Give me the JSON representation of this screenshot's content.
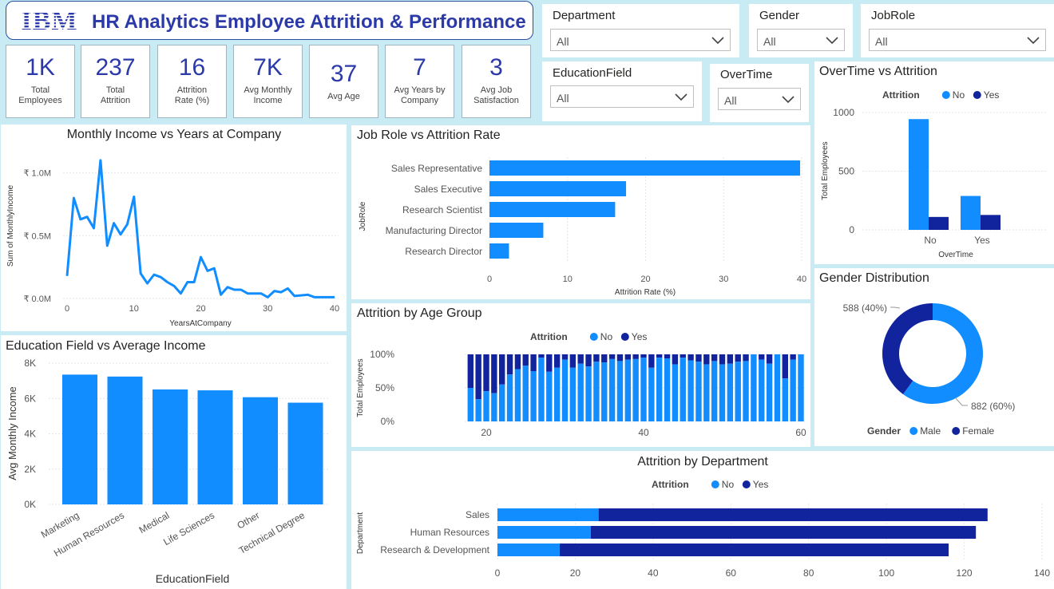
{
  "header": {
    "logo_text": "IBM",
    "title": "HR Analytics Employee Attrition & Performance"
  },
  "kpis": [
    {
      "value": "1K",
      "label_lines": [
        "Total",
        "Employees"
      ]
    },
    {
      "value": "237",
      "label_lines": [
        "Total",
        "Attrition"
      ]
    },
    {
      "value": "16",
      "label_lines": [
        "Attrition",
        "Rate (%)"
      ]
    },
    {
      "value": "7K",
      "label_lines": [
        "Avg Monthly",
        "Income"
      ]
    },
    {
      "value": "37",
      "label_lines": [
        "Avg Age"
      ]
    },
    {
      "value": "7",
      "label_lines": [
        "Avg Years by",
        "Company"
      ]
    },
    {
      "value": "3",
      "label_lines": [
        "Avg Job",
        "Satisfaction"
      ]
    }
  ],
  "slicers": {
    "department": {
      "title": "Department",
      "value": "All"
    },
    "gender": {
      "title": "Gender",
      "value": "All"
    },
    "jobrole": {
      "title": "JobRole",
      "value": "All"
    },
    "educationfield": {
      "title": "EducationField",
      "value": "All"
    },
    "overtime": {
      "title": "OverTime",
      "value": "All"
    }
  },
  "colors": {
    "no": "#118dff",
    "yes": "#12239e",
    "title": "#2b3aa8",
    "background": "#c9ecf4"
  },
  "chart_data": [
    {
      "id": "income_vs_years",
      "type": "line",
      "title": "Monthly Income vs Years at Company",
      "xlabel": "YearsAtCompany",
      "ylabel": "Sum of MonthlyIncome",
      "x_ticks": [
        "0",
        "10",
        "20",
        "30",
        "40"
      ],
      "y_ticks": [
        "₹ 0.0M",
        "₹ 0.5M",
        "₹ 1.0M"
      ],
      "xlim": [
        0,
        40
      ],
      "ylim": [
        0,
        1.15
      ],
      "x": [
        0,
        1,
        2,
        3,
        4,
        5,
        6,
        7,
        8,
        9,
        10,
        11,
        12,
        13,
        14,
        15,
        16,
        17,
        18,
        19,
        20,
        21,
        22,
        23,
        24,
        25,
        26,
        27,
        28,
        29,
        30,
        31,
        32,
        33,
        34,
        36,
        37,
        40
      ],
      "values": [
        0.18,
        0.8,
        0.63,
        0.65,
        0.56,
        1.1,
        0.42,
        0.6,
        0.51,
        0.59,
        0.81,
        0.2,
        0.12,
        0.19,
        0.17,
        0.13,
        0.1,
        0.04,
        0.13,
        0.13,
        0.33,
        0.22,
        0.24,
        0.03,
        0.09,
        0.07,
        0.07,
        0.04,
        0.04,
        0.04,
        0.01,
        0.06,
        0.05,
        0.08,
        0.02,
        0.03,
        0.01,
        0.01
      ]
    },
    {
      "id": "jobrole_attrition",
      "type": "bar",
      "orientation": "horizontal",
      "title": "Job Role vs Attrition Rate",
      "xlabel": "Attrition Rate (%)",
      "ylabel": "JobRole",
      "categories": [
        "Sales Representative",
        "Sales Executive",
        "Research Scientist",
        "Manufacturing Director",
        "Research Director"
      ],
      "values": [
        39.8,
        17.5,
        16.1,
        6.9,
        2.5
      ],
      "x_ticks": [
        "0",
        "10",
        "20",
        "30",
        "40"
      ],
      "xlim": [
        0,
        40
      ]
    },
    {
      "id": "overtime_attrition",
      "type": "bar",
      "title": "OverTime vs Attrition",
      "legend_title": "Attrition",
      "xlabel": "OverTime",
      "ylabel": "Total Employees",
      "categories": [
        "No",
        "Yes"
      ],
      "series": [
        {
          "name": "No",
          "values": [
            944,
            289
          ]
        },
        {
          "name": "Yes",
          "values": [
            110,
            127
          ]
        }
      ],
      "y_ticks": [
        "0",
        "500",
        "1000"
      ],
      "ylim": [
        0,
        1000
      ]
    },
    {
      "id": "gender_distribution",
      "type": "pie",
      "title": "Gender Distribution",
      "legend_title": "Gender",
      "categories": [
        "Male",
        "Female"
      ],
      "values": [
        882,
        588
      ],
      "labels": [
        "882 (60%)",
        "588 (40%)"
      ]
    },
    {
      "id": "attrition_by_age",
      "type": "bar",
      "stacked_percent": true,
      "title": "Attrition by Age Group",
      "legend_title": "Attrition",
      "ylabel": "Total Employees",
      "series_names": [
        "No",
        "Yes"
      ],
      "x": [
        18,
        19,
        20,
        21,
        22,
        23,
        24,
        25,
        26,
        27,
        28,
        29,
        30,
        31,
        32,
        33,
        34,
        35,
        36,
        37,
        38,
        39,
        40,
        41,
        42,
        43,
        44,
        45,
        46,
        47,
        48,
        49,
        50,
        51,
        52,
        53,
        54,
        55,
        56,
        57,
        58,
        59,
        60
      ],
      "no_share": [
        0.5,
        0.33,
        0.45,
        0.42,
        0.55,
        0.7,
        0.78,
        0.83,
        0.75,
        0.95,
        0.74,
        0.8,
        0.92,
        0.8,
        0.86,
        0.82,
        0.89,
        0.88,
        0.93,
        0.9,
        0.92,
        0.93,
        0.95,
        0.8,
        0.95,
        0.94,
        0.85,
        0.95,
        0.91,
        0.89,
        0.85,
        0.9,
        0.85,
        0.86,
        0.89,
        0.9,
        1.0,
        0.92,
        0.86,
        1.0,
        0.64,
        0.92,
        1.0
      ],
      "x_ticks": [
        "20",
        "40",
        "60"
      ],
      "y_ticks": [
        "0%",
        "50%",
        "100%"
      ]
    },
    {
      "id": "education_income",
      "type": "bar",
      "title": "Education Field vs Average Income",
      "xlabel": "EducationField",
      "ylabel": "Avg Monthly Income",
      "categories": [
        "Marketing",
        "Human Resources",
        "Medical",
        "Life Sciences",
        "Other",
        "Technical Degree"
      ],
      "values": [
        7350,
        7240,
        6510,
        6460,
        6070,
        5760
      ],
      "y_ticks": [
        "0K",
        "2K",
        "4K",
        "6K",
        "8K"
      ],
      "ylim": [
        0,
        8000
      ]
    },
    {
      "id": "attrition_by_department",
      "type": "bar",
      "orientation": "horizontal",
      "stacked": true,
      "title": "Attrition by Department",
      "legend_title": "Attrition",
      "ylabel": "Department",
      "categories": [
        "Sales",
        "Human Resources",
        "Research & Development"
      ],
      "series": [
        {
          "name": "No",
          "values": [
            26,
            24,
            16
          ]
        },
        {
          "name": "Yes",
          "values": [
            100,
            99,
            100
          ]
        }
      ],
      "x_ticks": [
        "0",
        "20",
        "40",
        "60",
        "80",
        "100",
        "120",
        "140"
      ],
      "xlim": [
        0,
        140
      ]
    }
  ]
}
